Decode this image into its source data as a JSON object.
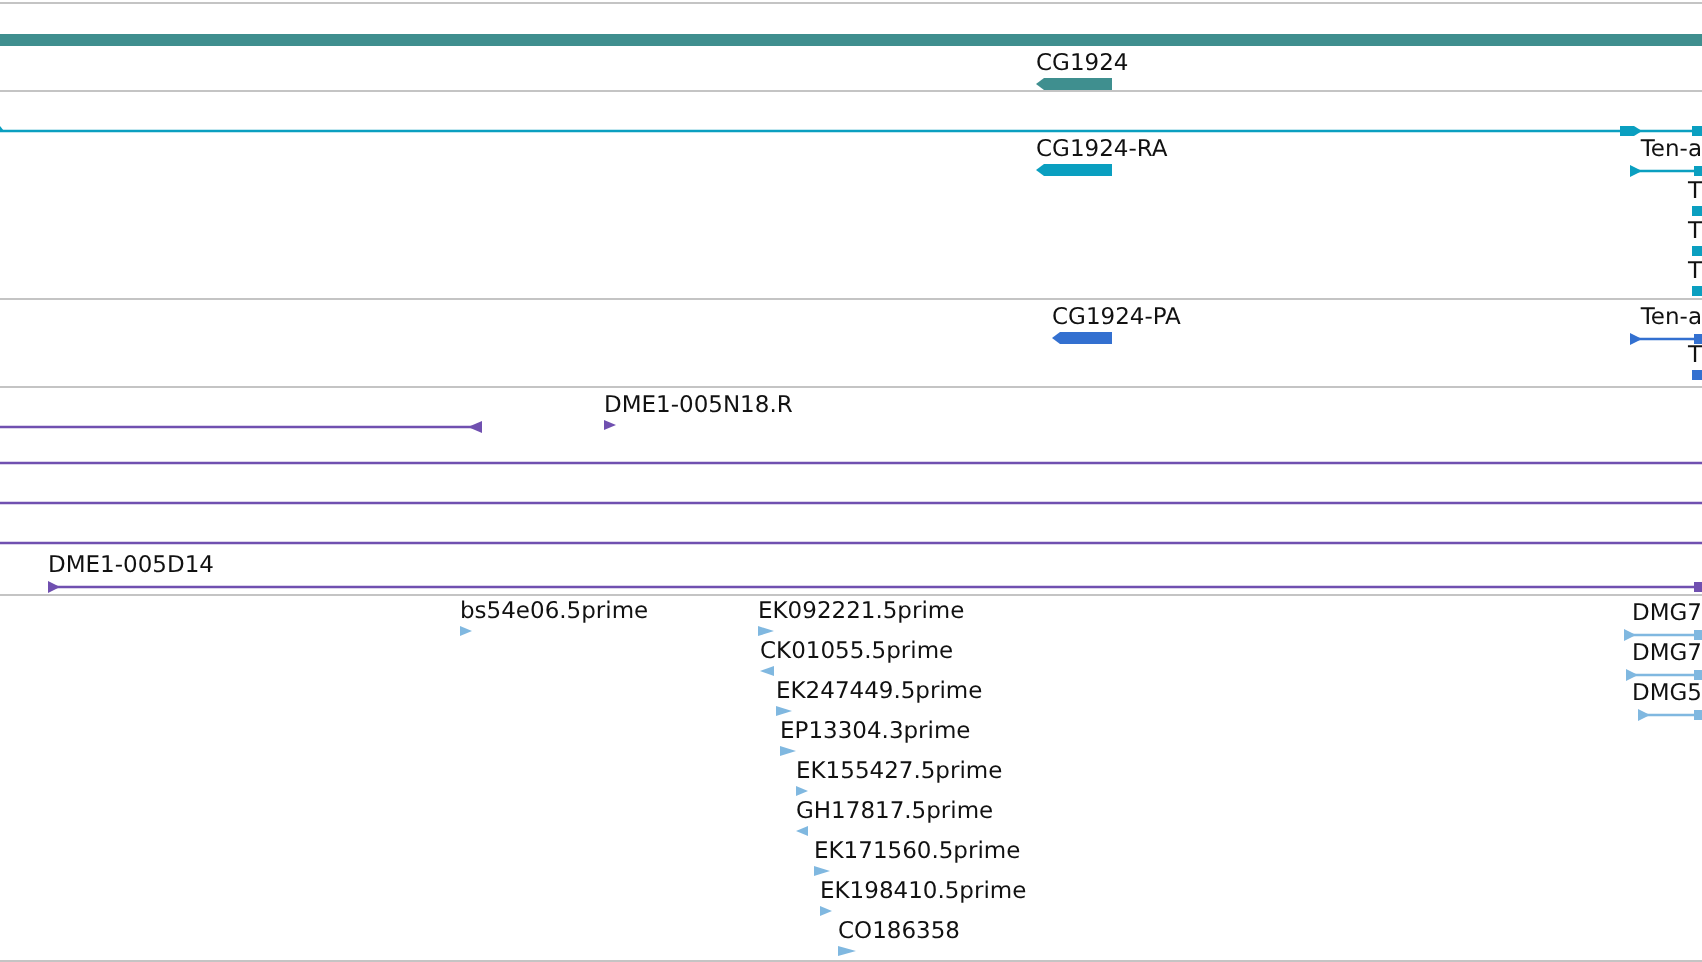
{
  "tracks": [
    {
      "kind": "gene",
      "color": "#3f8f8f",
      "features": [
        {
          "label": "CG1924",
          "reverse": true
        }
      ]
    },
    {
      "kind": "transcript",
      "color": "#0a9fc0",
      "features": [
        {
          "label": "CG1924-RA",
          "reverse": true
        },
        {
          "label": "Ten-a",
          "reverse": false
        },
        {
          "label": "T",
          "reverse": false
        },
        {
          "label": "T",
          "reverse": false
        },
        {
          "label": "T",
          "reverse": false
        }
      ]
    },
    {
      "kind": "protein",
      "color": "#3370d0",
      "features": [
        {
          "label": "CG1924-PA",
          "reverse": true
        },
        {
          "label": "Ten-a",
          "reverse": false
        },
        {
          "label": "T",
          "reverse": false
        }
      ]
    },
    {
      "kind": "clone",
      "color": "#7050b0",
      "features": [
        {
          "label": "DME1-005N18.R",
          "reverse": false
        },
        {
          "label": "DME1-005D14",
          "reverse": false
        }
      ]
    },
    {
      "kind": "est",
      "color": "#80b8e0",
      "features": [
        {
          "label": "bs54e06.5prime",
          "reverse": false
        },
        {
          "label": "EK092221.5prime",
          "reverse": false
        },
        {
          "label": "CK01055.5prime",
          "reverse": true
        },
        {
          "label": "EK247449.5prime",
          "reverse": false
        },
        {
          "label": "EP13304.3prime",
          "reverse": false
        },
        {
          "label": "EK155427.5prime",
          "reverse": false
        },
        {
          "label": "GH17817.5prime",
          "reverse": true
        },
        {
          "label": "EK171560.5prime",
          "reverse": false
        },
        {
          "label": "EK198410.5prime",
          "reverse": false
        },
        {
          "label": "CO186358",
          "reverse": false
        },
        {
          "label": "DMG7",
          "reverse": false
        },
        {
          "label": "DMG7",
          "reverse": false
        },
        {
          "label": "DMG5",
          "reverse": false
        }
      ]
    }
  ]
}
